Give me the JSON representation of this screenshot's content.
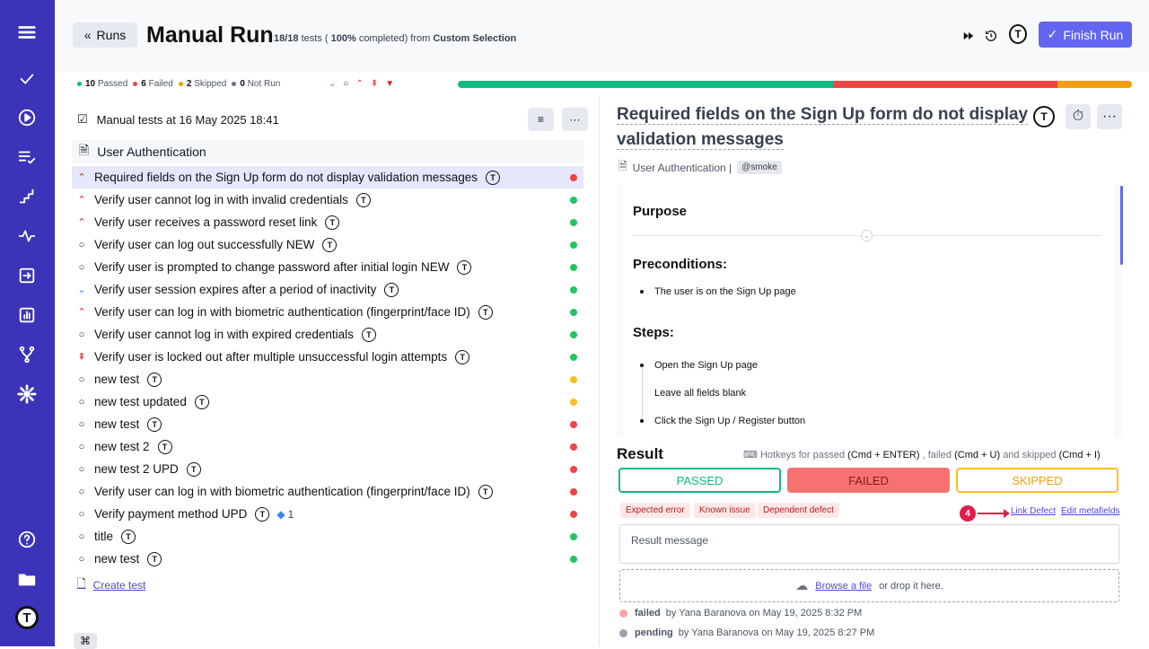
{
  "header": {
    "back_label": "Runs",
    "title": "Manual Run",
    "progress_count": "18/18",
    "progress_word": "tests (",
    "progress_pct": "100%",
    "progress_rest": "completed) from",
    "source": "Custom Selection",
    "finish_label": "Finish Run"
  },
  "stats": {
    "passed": "10",
    "passed_label": "Passed",
    "failed": "6",
    "failed_label": "Failed",
    "skipped": "2",
    "skipped_label": "Skipped",
    "notrun": "0",
    "notrun_label": "Not Run"
  },
  "progress": {
    "passed_fraction": 0.556,
    "failed_fraction": 0.333,
    "skipped_fraction": 0.111,
    "colors": {
      "passed": "#10b981",
      "failed": "#ef4444",
      "skipped": "#f59e0b"
    }
  },
  "left": {
    "header": "Manual tests at 16 May 2025 18:41",
    "suite": "User Authentication",
    "create_test": "Create test",
    "tests": [
      {
        "title": "Required fields on the Sign Up form do not display validation messages",
        "priority": "up",
        "status": "failed",
        "selected": true
      },
      {
        "title": "Verify user cannot log in with invalid credentials",
        "priority": "up",
        "status": "passed"
      },
      {
        "title": "Verify user receives a password reset link",
        "priority": "up",
        "status": "passed"
      },
      {
        "title": "Verify user can log out successfully NEW",
        "priority": "normal",
        "status": "passed"
      },
      {
        "title": "Verify user is prompted to change password after initial login NEW",
        "priority": "normal",
        "status": "passed"
      },
      {
        "title": "Verify user session expires after a period of inactivity",
        "priority": "down",
        "status": "passed"
      },
      {
        "title": "Verify user can log in with biometric authentication (fingerprint/face ID)",
        "priority": "up",
        "status": "passed"
      },
      {
        "title": "Verify user cannot log in with expired credentials",
        "priority": "normal",
        "status": "passed"
      },
      {
        "title": "Verify user is locked out after multiple unsuccessful login attempts",
        "priority": "critical",
        "status": "passed"
      },
      {
        "title": "new test",
        "priority": "normal",
        "status": "skipped"
      },
      {
        "title": "new test updated",
        "priority": "normal",
        "status": "skipped"
      },
      {
        "title": "new test",
        "priority": "normal",
        "status": "failed"
      },
      {
        "title": "new test 2",
        "priority": "normal",
        "status": "failed"
      },
      {
        "title": "new test 2 UPD",
        "priority": "normal",
        "status": "failed"
      },
      {
        "title": "Verify user can log in with biometric authentication (fingerprint/face ID)",
        "priority": "normal",
        "status": "failed"
      },
      {
        "title": "Verify payment method UPD",
        "priority": "normal",
        "status": "failed",
        "jira": "1"
      },
      {
        "title": "title",
        "priority": "normal",
        "status": "passed"
      },
      {
        "title": "new test",
        "priority": "normal",
        "status": "passed"
      }
    ]
  },
  "right": {
    "title": "Required fields on the Sign Up form do not display validation messages",
    "suite": "User Authentication |",
    "tag": "@smoke",
    "purpose": "Purpose",
    "preconditions": "Preconditions:",
    "precondition_items": [
      "The user is on the Sign Up page"
    ],
    "steps": "Steps:",
    "step_items": [
      "Open the Sign Up page",
      "Leave all fields blank",
      "Click the Sign Up / Register button"
    ],
    "result_label": "Result",
    "hotkeys_text": "Hotkeys for passed",
    "hk_passed": "(Cmd + ENTER)",
    "hk_failed_label": ", failed",
    "hk_failed": "(Cmd + U)",
    "hk_skipped_label": "and skipped",
    "hk_skipped": "(Cmd + I)",
    "passed_btn": "PASSED",
    "failed_btn": "FAILED",
    "skipped_btn": "SKIPPED",
    "chips": [
      "Expected error",
      "Known issue",
      "Dependent defect"
    ],
    "badge": "4",
    "link_defect": "Link Defect",
    "edit_metafields": "Edit metafields",
    "result_placeholder": "Result message",
    "browse": "Browse a file",
    "drop": "or drop it here.",
    "history": [
      {
        "status": "failed",
        "text": "by Yana Baranova on May 19, 2025 8:32 PM"
      },
      {
        "status": "pending",
        "text": "by Yana Baranova on May 19, 2025 8:27 PM"
      }
    ]
  }
}
